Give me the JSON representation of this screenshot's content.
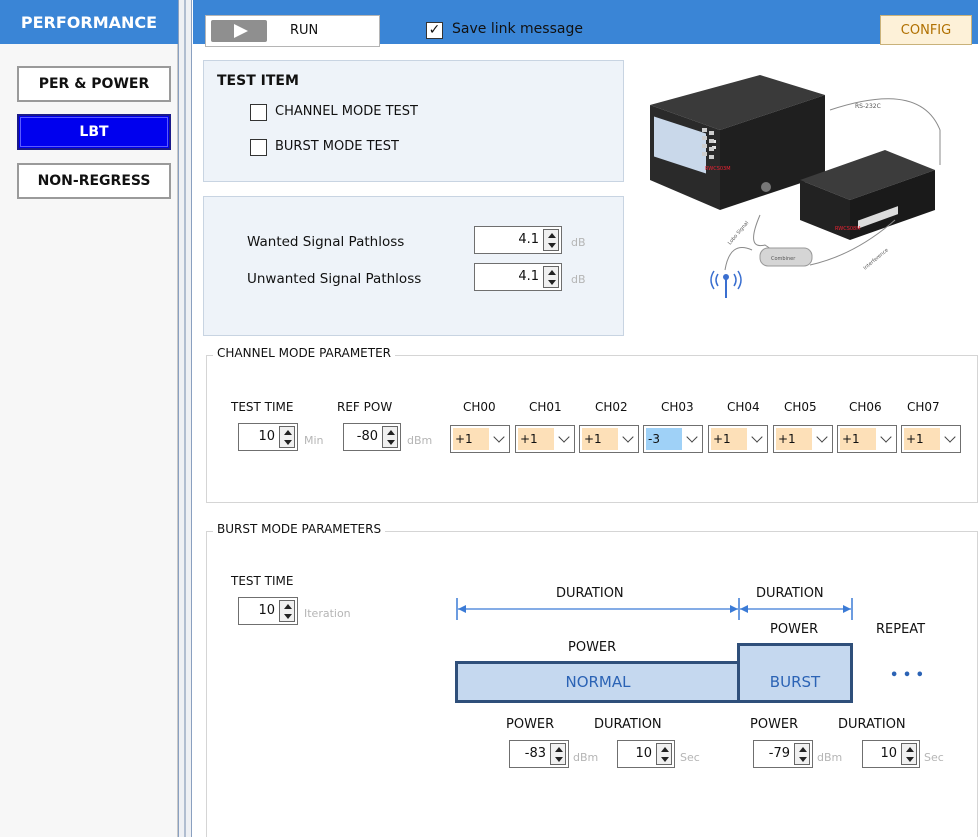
{
  "sidebar": {
    "title": "PERFORMANCE",
    "items": [
      {
        "label": "PER & POWER",
        "active": false
      },
      {
        "label": "LBT",
        "active": true
      },
      {
        "label": "NON-REGRESS",
        "active": false
      }
    ]
  },
  "toolbar": {
    "run_label": "RUN",
    "save_link_label": "Save link message",
    "save_link_checked": true,
    "config_label": "CONFIG"
  },
  "test_item": {
    "title": "TEST ITEM",
    "channel_mode_label": "CHANNEL MODE TEST",
    "burst_mode_label": "BURST MODE TEST"
  },
  "pathloss": {
    "wanted_label": "Wanted Signal Pathloss",
    "wanted_value": "4.1",
    "unwanted_label": "Unwanted Signal Pathloss",
    "unwanted_value": "4.1",
    "unit": "dB"
  },
  "device": {
    "rs232c": "RS-232C",
    "combiner": "Combiner",
    "lobo_signal": "Lobo Signal",
    "interference": "Interference"
  },
  "channel_mode": {
    "title": "CHANNEL MODE PARAMETER",
    "test_time_label": "TEST TIME",
    "test_time_value": "10",
    "test_time_unit": "Min",
    "ref_pow_label": "REF POW",
    "ref_pow_value": "-80",
    "ref_pow_unit": "dBm",
    "channels": [
      {
        "name": "CH00",
        "value": "+1"
      },
      {
        "name": "CH01",
        "value": "+1"
      },
      {
        "name": "CH02",
        "value": "+1"
      },
      {
        "name": "CH03",
        "value": "-3"
      },
      {
        "name": "CH04",
        "value": "+1"
      },
      {
        "name": "CH05",
        "value": "+1"
      },
      {
        "name": "CH06",
        "value": "+1"
      },
      {
        "name": "CH07",
        "value": "+1"
      }
    ]
  },
  "burst_mode": {
    "title": "BURST MODE PARAMETERS",
    "test_time_label": "TEST TIME",
    "test_time_value": "10",
    "test_time_unit": "Iteration",
    "diagram": {
      "duration_label": "DURATION",
      "power_label": "POWER",
      "repeat_label": "REPEAT",
      "normal_label": "NORMAL",
      "burst_label": "BURST",
      "ellipsis": "• • •"
    },
    "normal": {
      "power_label": "POWER",
      "power_value": "-83",
      "power_unit": "dBm",
      "duration_label": "DURATION",
      "duration_value": "10",
      "duration_unit": "Sec"
    },
    "burst": {
      "power_label": "POWER",
      "power_value": "-79",
      "power_unit": "dBm",
      "duration_label": "DURATION",
      "duration_value": "10",
      "duration_unit": "Sec"
    }
  }
}
